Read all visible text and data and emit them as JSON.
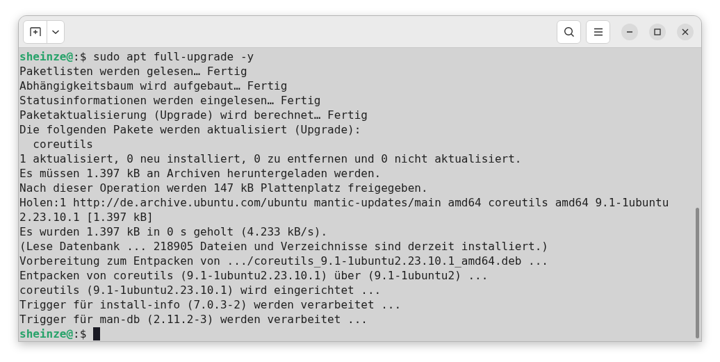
{
  "header": {
    "buttons": [
      {
        "kind": "new-tab"
      },
      {
        "kind": "dropdown"
      },
      {
        "kind": "search"
      },
      {
        "kind": "menu"
      },
      {
        "kind": "minimize"
      },
      {
        "kind": "maximize"
      },
      {
        "kind": "close"
      }
    ]
  },
  "terminal": {
    "lines": [
      {
        "kind": "prompt",
        "user": "sheinze@",
        "symbol": ":$",
        "command": "sudo apt full-upgrade -y",
        "cursor": false
      },
      {
        "kind": "output",
        "text": "Paketlisten werden gelesen… Fertig"
      },
      {
        "kind": "output",
        "text": "Abhängigkeitsbaum wird aufgebaut… Fertig"
      },
      {
        "kind": "output",
        "text": "Statusinformationen werden eingelesen… Fertig"
      },
      {
        "kind": "output",
        "text": "Paketaktualisierung (Upgrade) wird berechnet… Fertig"
      },
      {
        "kind": "output",
        "text": "Die folgenden Pakete werden aktualisiert (Upgrade):"
      },
      {
        "kind": "output",
        "text": "  coreutils"
      },
      {
        "kind": "output",
        "text": "1 aktualisiert, 0 neu installiert, 0 zu entfernen und 0 nicht aktualisiert."
      },
      {
        "kind": "output",
        "text": "Es müssen 1.397 kB an Archiven heruntergeladen werden."
      },
      {
        "kind": "output",
        "text": "Nach dieser Operation werden 147 kB Plattenplatz freigegeben."
      },
      {
        "kind": "output",
        "text": "Holen:1 http://de.archive.ubuntu.com/ubuntu mantic-updates/main amd64 coreutils amd64 9.1-1ubuntu"
      },
      {
        "kind": "output",
        "text": "2.23.10.1 [1.397 kB]"
      },
      {
        "kind": "output",
        "text": "Es wurden 1.397 kB in 0 s geholt (4.233 kB/s)."
      },
      {
        "kind": "output",
        "text": "(Lese Datenbank ... 218905 Dateien und Verzeichnisse sind derzeit installiert.)"
      },
      {
        "kind": "output",
        "text": "Vorbereitung zum Entpacken von .../coreutils_9.1-1ubuntu2.23.10.1_amd64.deb ..."
      },
      {
        "kind": "output",
        "text": "Entpacken von coreutils (9.1-1ubuntu2.23.10.1) über (9.1-1ubuntu2) ..."
      },
      {
        "kind": "output",
        "text": "coreutils (9.1-1ubuntu2.23.10.1) wird eingerichtet ..."
      },
      {
        "kind": "output",
        "text": "Trigger für install-info (7.0.3-2) werden verarbeitet ..."
      },
      {
        "kind": "output",
        "text": "Trigger für man-db (2.11.2-3) werden verarbeitet ..."
      },
      {
        "kind": "prompt",
        "user": "sheinze@",
        "symbol": ":$",
        "cursor": true
      }
    ]
  }
}
